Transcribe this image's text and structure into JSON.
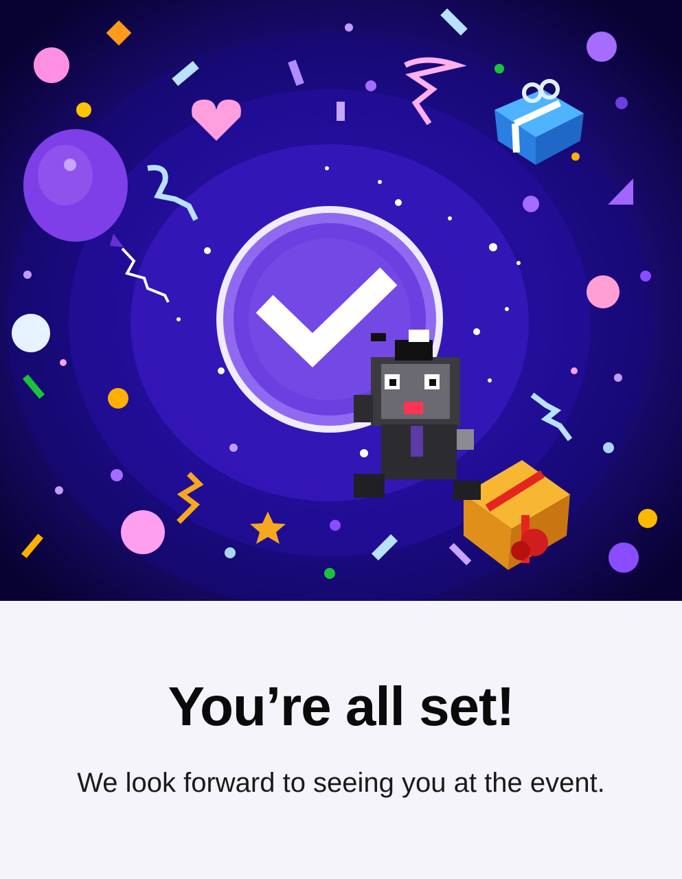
{
  "confirmation": {
    "title": "You’re all set!",
    "message": "We look forward to seeing you at the event."
  },
  "illustration": {
    "icons": [
      "check-icon",
      "mascot",
      "balloon-icon",
      "gift-icon",
      "heart-icon",
      "star-icon",
      "confetti"
    ],
    "colors": {
      "background": "#0b0433",
      "ring_outer": "#1a0c73",
      "ring_mid": "#2a11a8",
      "ring_inner": "#4a22c9",
      "badge": "#6b3fe0",
      "badge_border": "#e9e3ff",
      "check": "#ffffff",
      "panel": "#f4f4fa"
    }
  }
}
